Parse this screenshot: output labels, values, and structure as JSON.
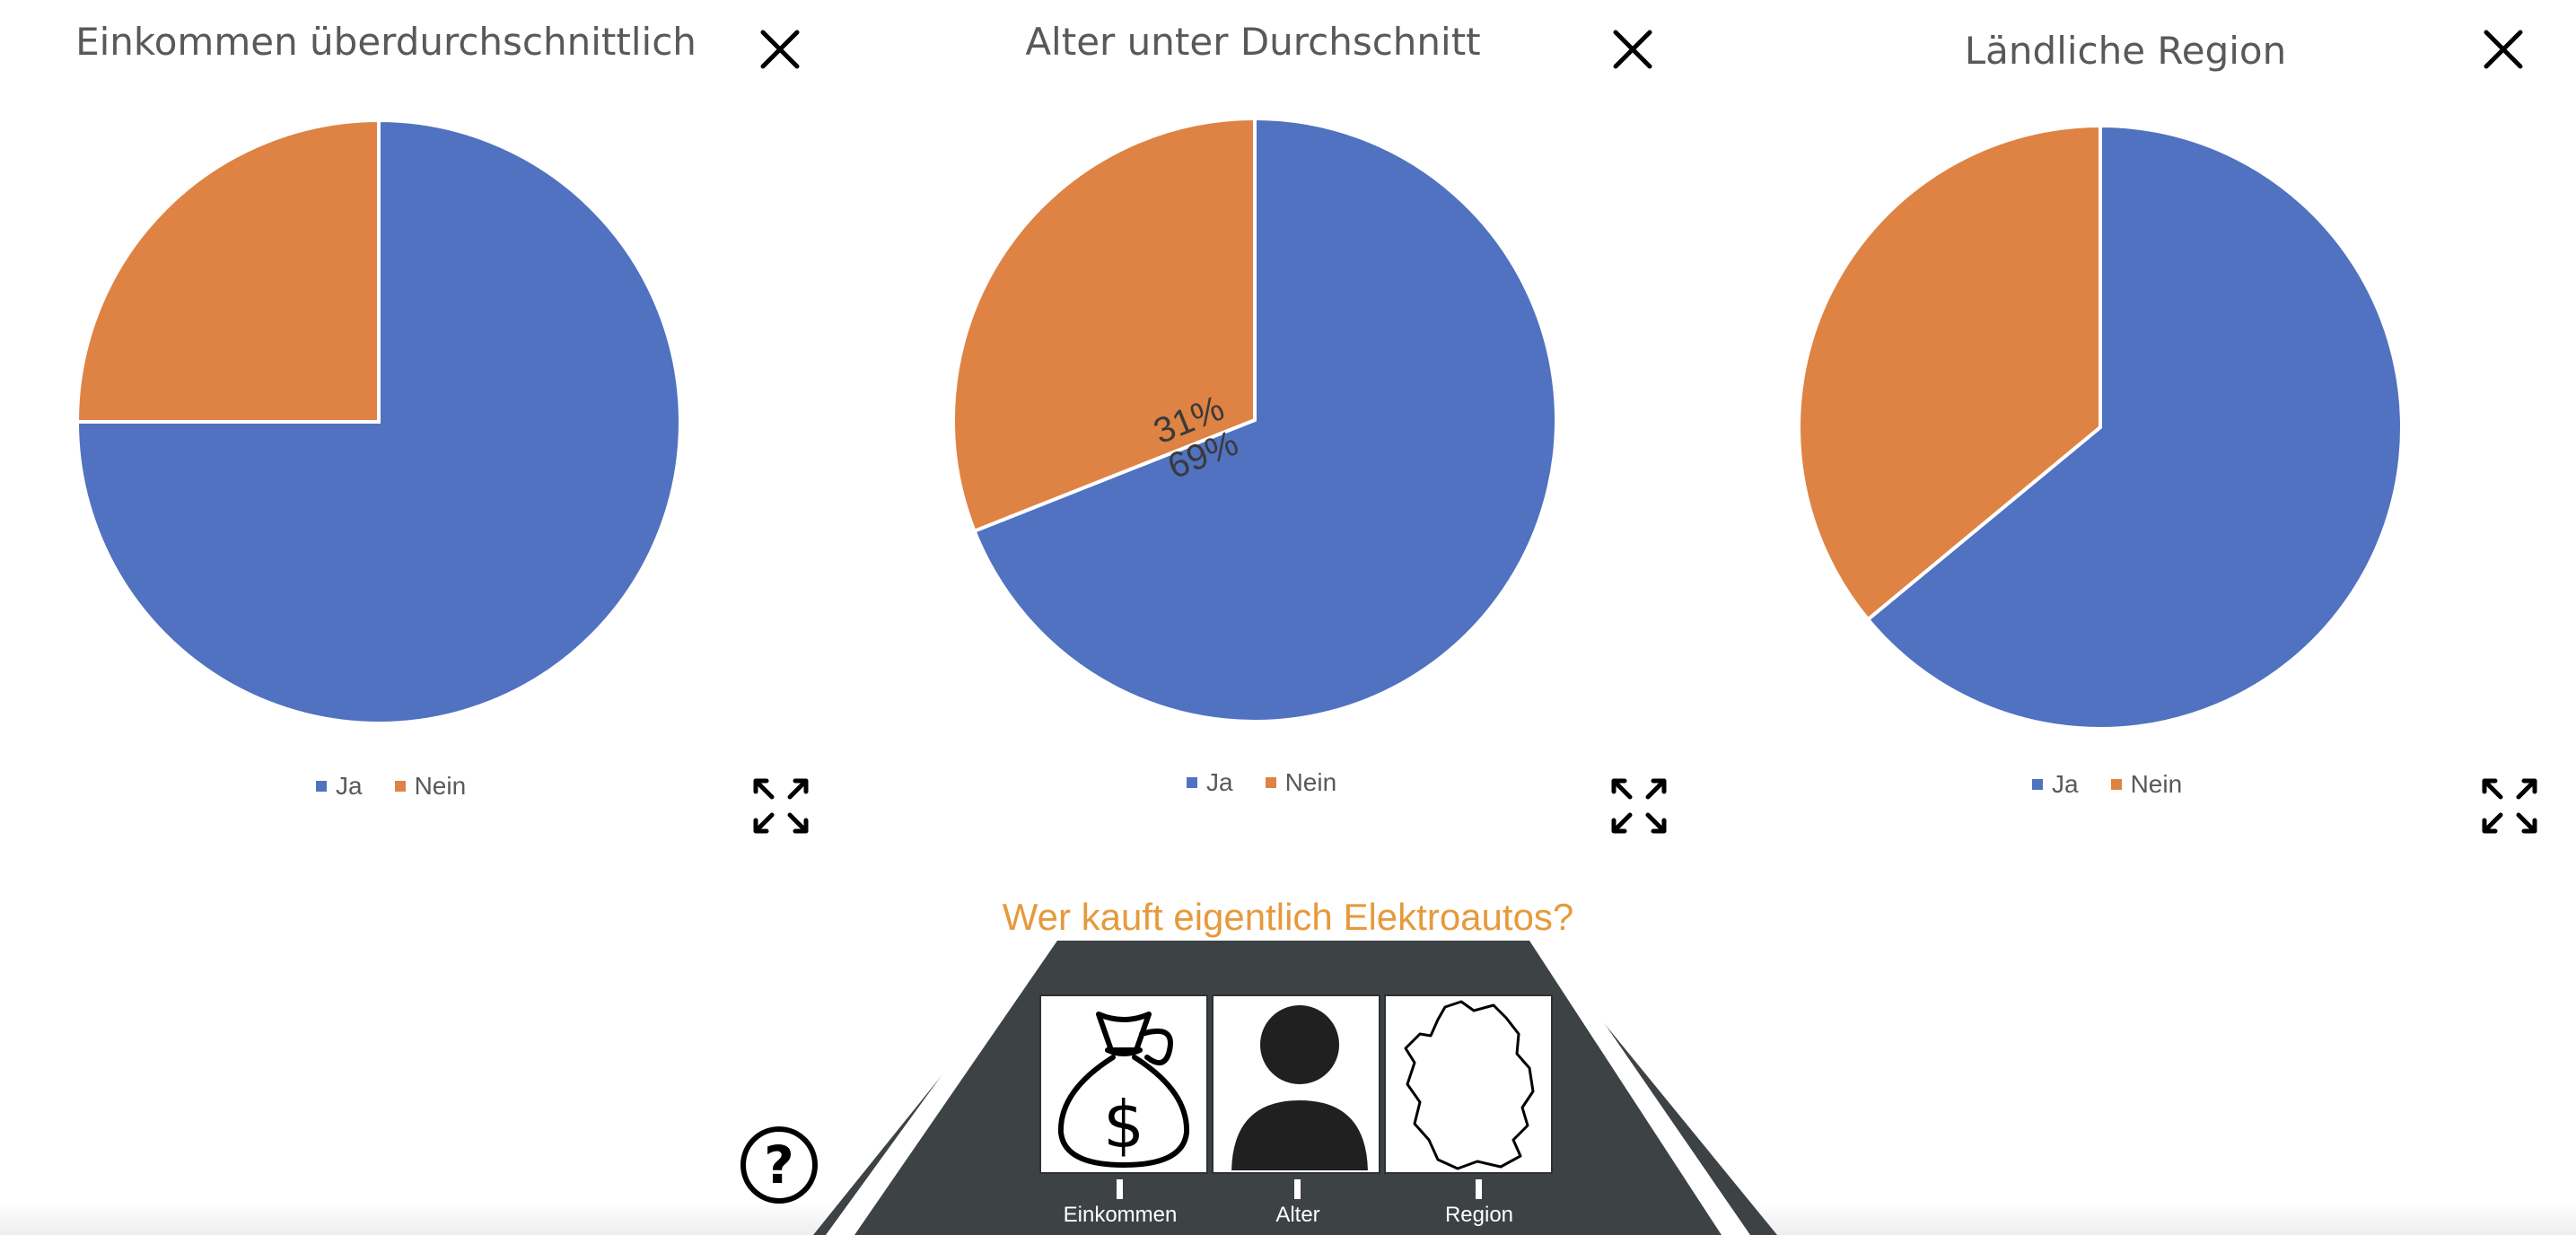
{
  "page": {
    "subtitle": "Wer kauft eigentlich Elektroautos?",
    "colors": {
      "subtitle": "#e59a3b",
      "road": "#3d4245",
      "ja": "#5072c0",
      "nein": "#de8344"
    }
  },
  "chart_data": [
    {
      "type": "pie",
      "title": "Einkommen überdurchschnittlich",
      "categories": [
        "Ja",
        "Nein"
      ],
      "values": [
        75,
        25
      ],
      "data_labels": [
        "",
        ""
      ],
      "colors": [
        "#5072c0",
        "#de8344"
      ],
      "legend": "bottom"
    },
    {
      "type": "pie",
      "title": "Alter unter Durchschnitt",
      "categories": [
        "Ja",
        "Nein"
      ],
      "values": [
        69,
        31
      ],
      "data_labels": [
        "69%",
        "31%"
      ],
      "colors": [
        "#5072c0",
        "#de8344"
      ],
      "legend": "bottom"
    },
    {
      "type": "pie",
      "title": "Ländliche Region",
      "categories": [
        "Ja",
        "Nein"
      ],
      "values": [
        64,
        36
      ],
      "data_labels": [
        "",
        ""
      ],
      "colors": [
        "#5072c0",
        "#de8344"
      ],
      "legend": "bottom"
    }
  ],
  "categories_bar": {
    "items": [
      {
        "label": "Einkommen",
        "icon": "money-bag-icon"
      },
      {
        "label": "Alter",
        "icon": "person-icon"
      },
      {
        "label": "Region",
        "icon": "germany-map-icon"
      }
    ]
  },
  "icons": {
    "close": "close-icon",
    "expand": "expand-icon",
    "help": "help-icon"
  }
}
